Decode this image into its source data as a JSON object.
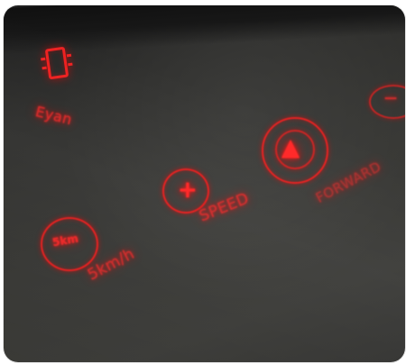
{
  "panel": {
    "rows": [
      {
        "key": "timer",
        "label": "Eyan",
        "icon": "rectangle-display-icon"
      },
      {
        "key": "speed",
        "label": "SPEED",
        "icon": "plus-icon"
      },
      {
        "key": "forward",
        "label": "FORWARD",
        "icon": "triangle-up-icon"
      },
      {
        "key": "quickset",
        "label": "5km/h",
        "badge": "5km"
      }
    ]
  },
  "colors": {
    "panel": "#343431",
    "led": "#ff2a2a"
  }
}
